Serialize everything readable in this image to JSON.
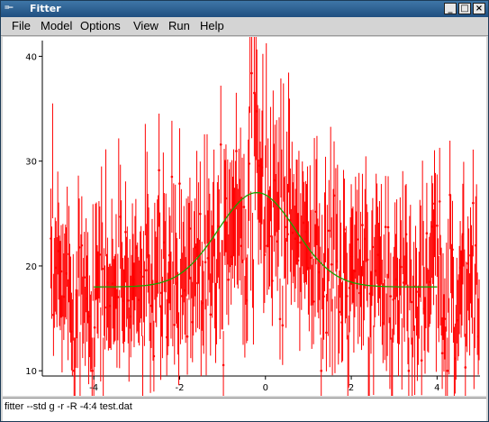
{
  "window": {
    "title": "Fitter",
    "menu_icon": "=−",
    "minimize_glyph": "_",
    "maximize_glyph": "□",
    "close_glyph": "×",
    "titlebar_color": "#2b5f93"
  },
  "menubar": {
    "items": [
      "File",
      "Model",
      "Options",
      "View",
      "Run",
      "Help"
    ]
  },
  "status": {
    "command": "fitter --std g -r -R -4:4 test.dat"
  },
  "chart_data": {
    "type": "scatter",
    "title": "",
    "xlabel": "",
    "ylabel": "",
    "xlim": [
      -5.2,
      5.0
    ],
    "ylim": [
      9.5,
      41.5
    ],
    "x_ticks": [
      -4,
      -2,
      0,
      2,
      4
    ],
    "y_ticks": [
      10,
      20,
      30,
      40
    ],
    "grid": false,
    "legend": "none",
    "colors": {
      "data": "#ff0000",
      "fit": "#1aa000"
    },
    "series": [
      {
        "kind": "data_with_errorbars",
        "x_range": [
          -5.0,
          4.98
        ],
        "n_points": 500,
        "baseline": 18,
        "peak_height": 9,
        "peak_center": -0.2,
        "peak_sigma": 0.9,
        "y_min_observed": 10,
        "y_max_observed": 41
      },
      {
        "kind": "fit_curve",
        "x_range": [
          -4,
          4
        ],
        "baseline": 18,
        "amplitude": 9,
        "center": -0.2,
        "sigma": 0.9
      }
    ]
  }
}
